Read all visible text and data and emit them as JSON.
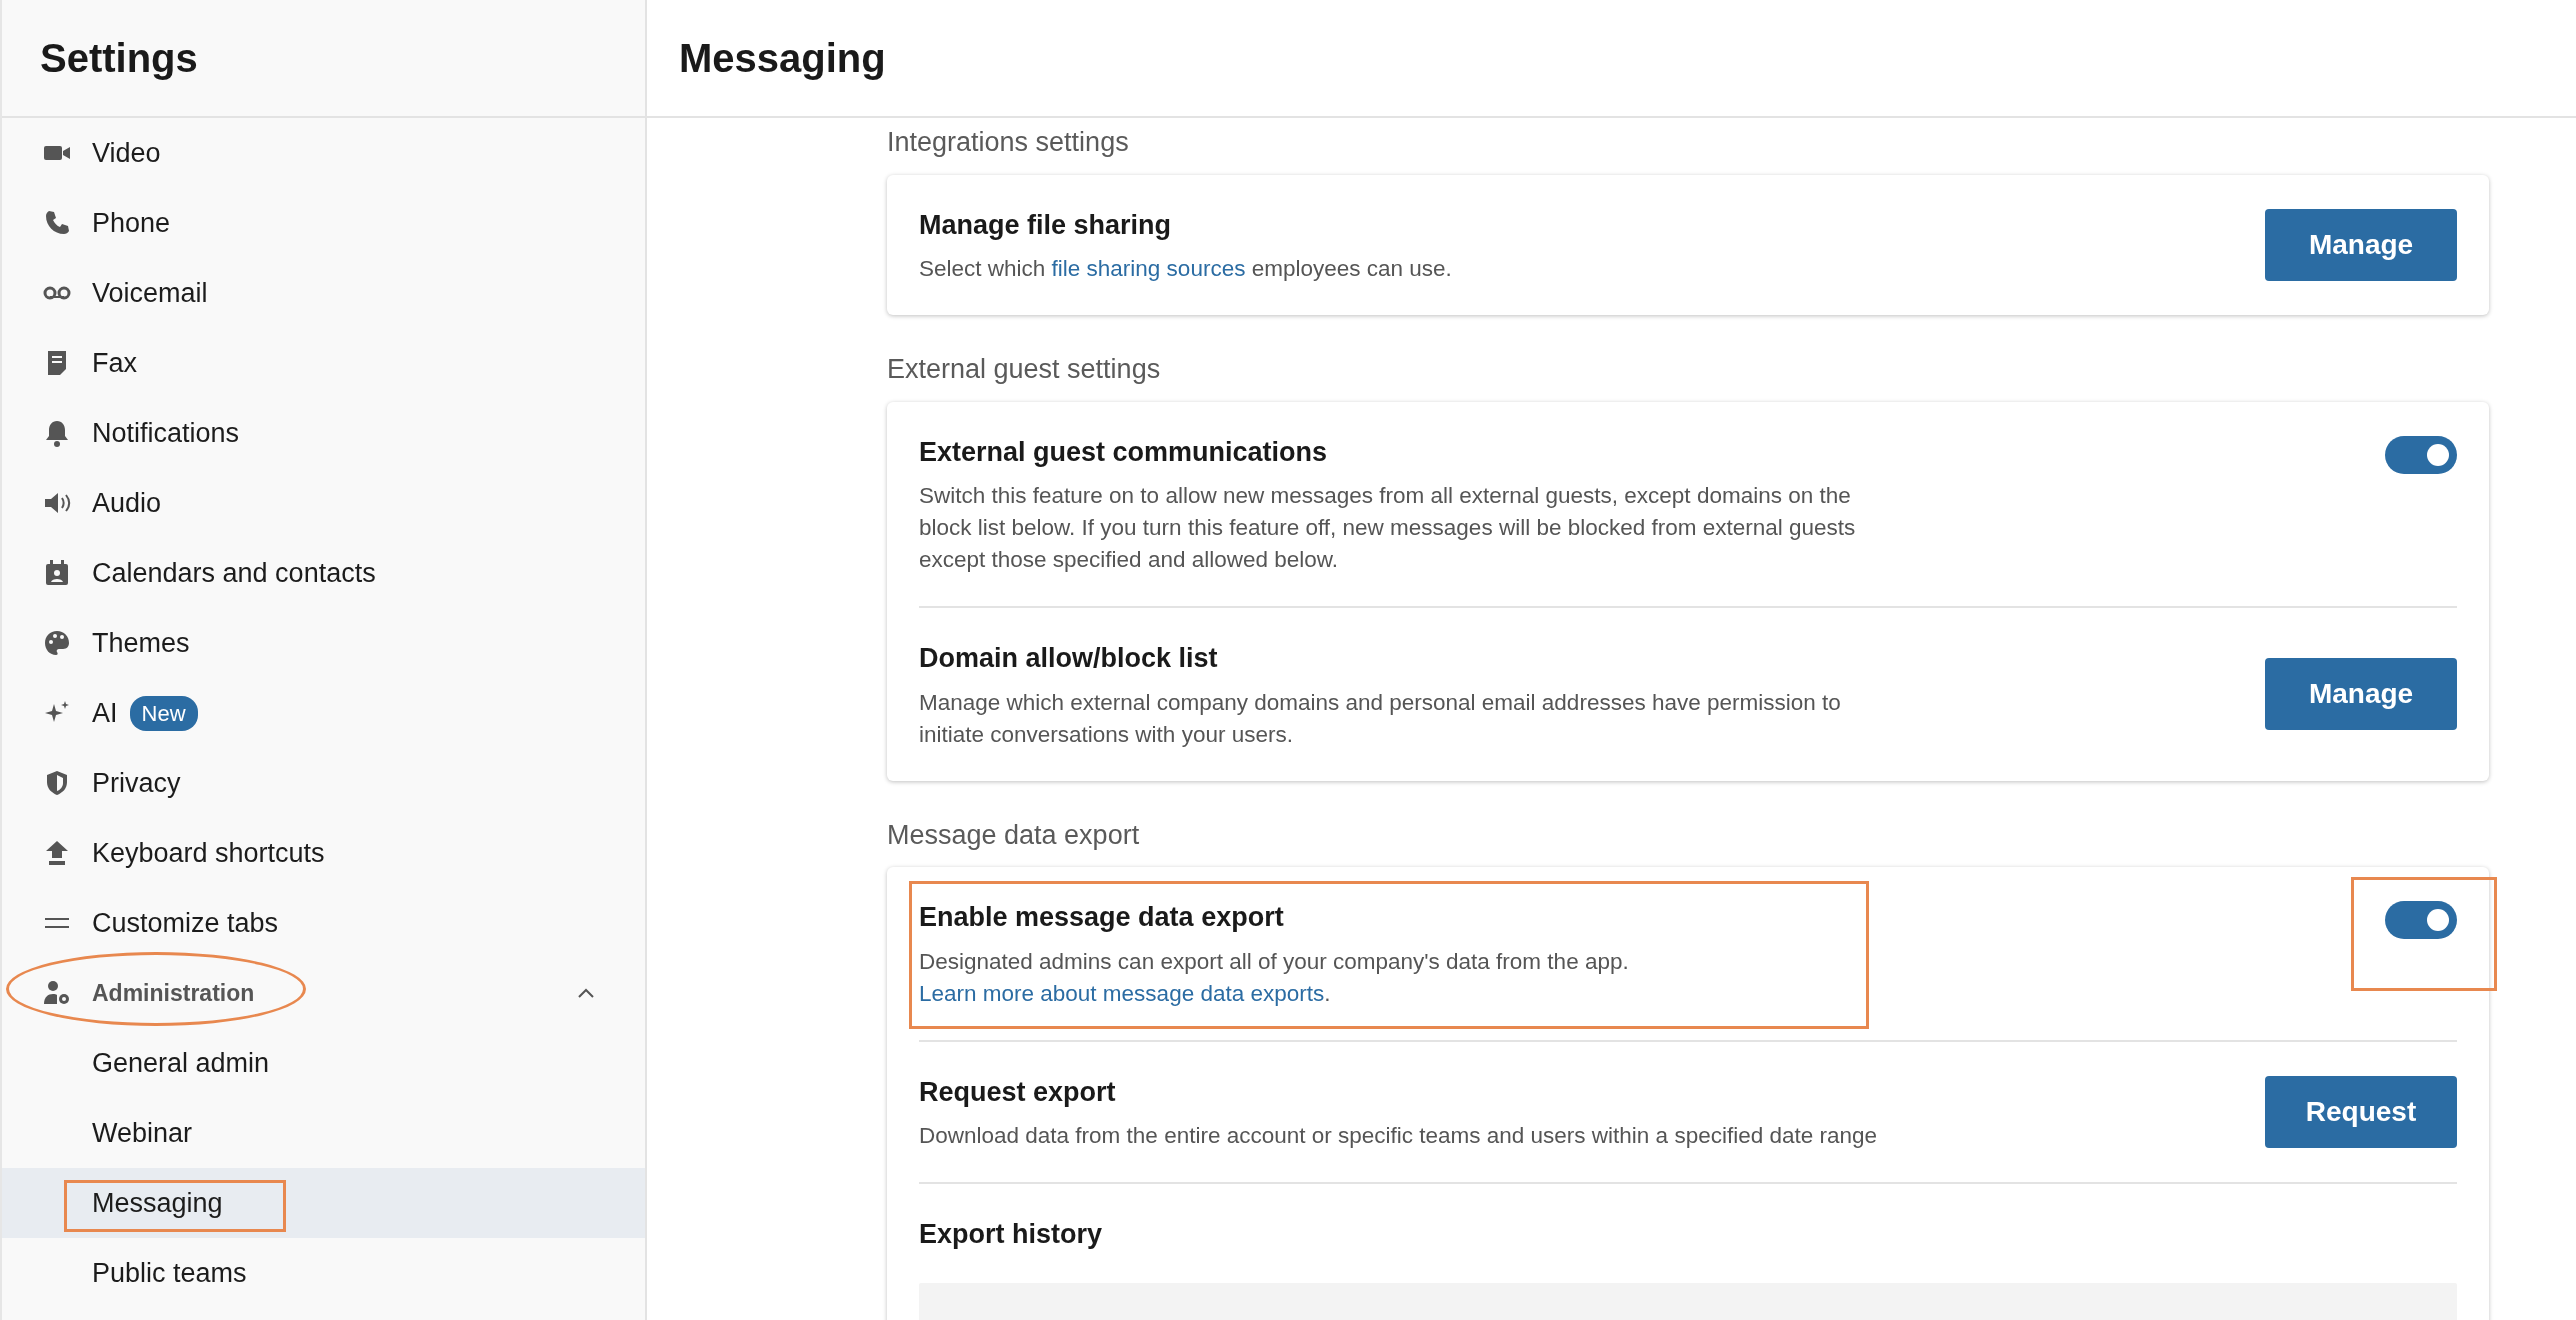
{
  "window": {
    "title": "Settings"
  },
  "sidebar": {
    "items": [
      {
        "label": "Video",
        "selected": false
      },
      {
        "label": "Phone",
        "selected": false
      },
      {
        "label": "Voicemail",
        "selected": false
      },
      {
        "label": "Fax",
        "selected": false
      },
      {
        "label": "Notifications",
        "selected": false
      },
      {
        "label": "Audio",
        "selected": false
      },
      {
        "label": "Calendars and contacts",
        "selected": false
      },
      {
        "label": "Themes",
        "selected": false
      },
      {
        "label": "AI",
        "badge": "New",
        "selected": false
      },
      {
        "label": "Privacy",
        "selected": false
      },
      {
        "label": "Keyboard shortcuts",
        "selected": false
      },
      {
        "label": "Customize tabs",
        "selected": false
      },
      {
        "label": "Administration",
        "selected": false,
        "expanded": true,
        "circled": true,
        "children": [
          {
            "label": "General admin",
            "selected": false
          },
          {
            "label": "Webinar",
            "selected": false
          },
          {
            "label": "Messaging",
            "selected": true,
            "boxed": true
          },
          {
            "label": "Public teams",
            "selected": false
          }
        ]
      }
    ]
  },
  "page": {
    "title": "Messaging"
  },
  "sections": [
    {
      "heading": "Integrations settings",
      "rows": [
        {
          "kind": "button",
          "title": "Manage file sharing",
          "description": [
            {
              "text": "Select which "
            },
            {
              "text": "file sharing sources",
              "link": true
            },
            {
              "text": " employees can use."
            }
          ],
          "button": "Manage"
        }
      ]
    },
    {
      "heading": "External guest settings",
      "rows": [
        {
          "kind": "toggle",
          "title": "External guest communications",
          "description": [
            {
              "text": "Switch this feature on to allow new messages from all external guests, except domains on the block list below. If you turn this feature off, new messages will be blocked from external guests except those specified and allowed below."
            }
          ],
          "on": true
        },
        {
          "kind": "button",
          "title": "Domain allow/block list",
          "description": [
            {
              "text": "Manage which external company domains and personal email addresses have permission to initiate conversations with your users."
            }
          ],
          "button": "Manage"
        }
      ]
    },
    {
      "heading": "Message data export",
      "rows": [
        {
          "kind": "toggle",
          "title": "Enable message data export",
          "description": [
            {
              "text": "Designated admins can export all of your company's data from the app. "
            },
            {
              "text": "Learn more about message data exports",
              "link": true
            },
            {
              "text": "."
            }
          ],
          "on": true,
          "boxed_text": true,
          "boxed_control": true
        },
        {
          "kind": "button",
          "title": "Request export",
          "description": [
            {
              "text": "Download data from the entire account or specific teams and users within a specified date range"
            }
          ],
          "button": "Request"
        },
        {
          "kind": "table",
          "title": "Export history"
        }
      ]
    }
  ]
}
